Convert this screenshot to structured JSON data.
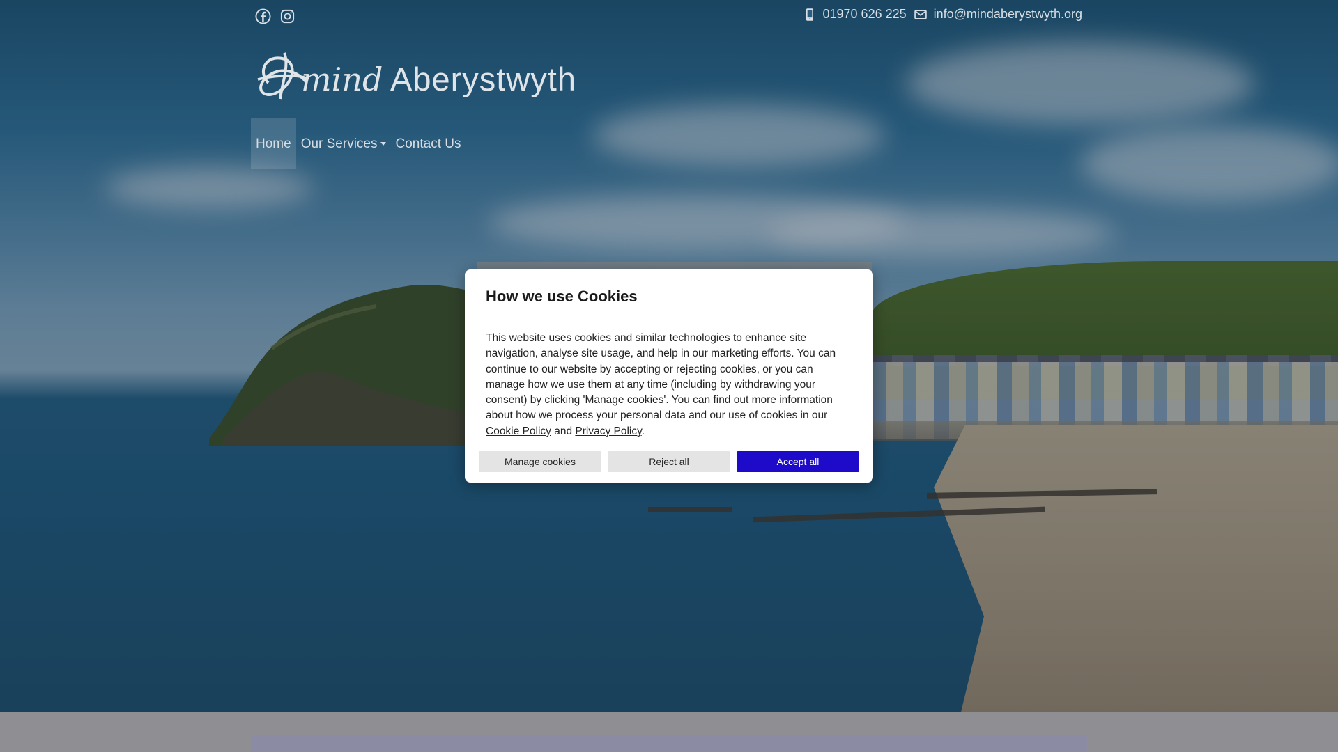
{
  "topbar": {
    "social": [
      {
        "icon": "facebook-icon"
      },
      {
        "icon": "instagram-icon"
      }
    ],
    "phone": {
      "icon": "mobile-phone-icon",
      "text": "01970 626 225"
    },
    "email": {
      "icon": "envelope-icon",
      "text": "info@mindaberystwyth.org"
    }
  },
  "logo": {
    "icon": "mind-logo-icon",
    "brand": "mind",
    "place": "Aberystwyth"
  },
  "nav": {
    "items": [
      {
        "label": "Home",
        "active": true
      },
      {
        "label": "Our Services",
        "has_dropdown": true
      },
      {
        "label": "Contact Us"
      }
    ]
  },
  "cookie_modal": {
    "title": "How we use Cookies",
    "body_text": "This website uses cookies and similar technologies to enhance site navigation, analyse site usage, and help in our marketing efforts. You can continue to our website by accepting or rejecting cookies, or you can manage how we use them at any time (including by withdrawing your consent) by clicking 'Manage cookies'. You can find out more information about how we process your personal data and our use of cookies in our",
    "cookie_policy_link": "Cookie Policy",
    "and_text": "and",
    "privacy_policy_link": "Privacy Policy",
    "period": ".",
    "buttons": {
      "manage": "Manage cookies",
      "reject": "Reject all",
      "accept": "Accept all"
    },
    "accent_color": "#1d0bc9"
  }
}
